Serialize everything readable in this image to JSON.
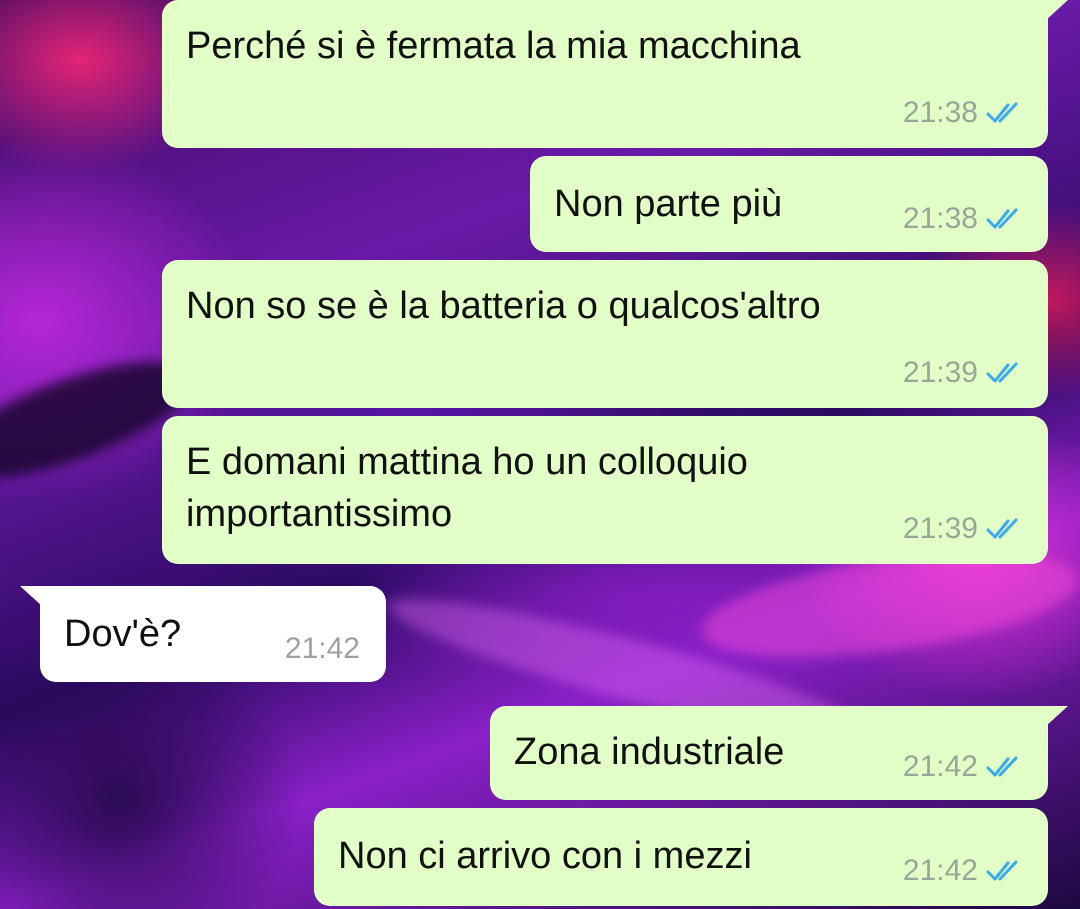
{
  "colors": {
    "outgoing_bubble": "#e2ffc7",
    "incoming_bubble": "#ffffff",
    "read_ticks": "#3aa9ee"
  },
  "messages": [
    {
      "direction": "outgoing",
      "text": "Perché si è fermata la mia macchina",
      "time": "21:38",
      "status_icon": "double-check-icon"
    },
    {
      "direction": "outgoing",
      "text": "Non parte più",
      "time": "21:38",
      "status_icon": "double-check-icon"
    },
    {
      "direction": "outgoing",
      "text": "Non so se è la batteria o qualcos'altro",
      "time": "21:39",
      "status_icon": "double-check-icon"
    },
    {
      "direction": "outgoing",
      "text_line1": "E domani mattina ho un colloquio",
      "text_line2": "importantissimo",
      "time": "21:39",
      "status_icon": "double-check-icon"
    },
    {
      "direction": "incoming",
      "text": "Dov'è?",
      "time": "21:42"
    },
    {
      "direction": "outgoing",
      "text": "Zona industriale",
      "time": "21:42",
      "status_icon": "double-check-icon"
    },
    {
      "direction": "outgoing",
      "text": "Non ci arrivo con i mezzi",
      "time": "21:42",
      "status_icon": "double-check-icon"
    }
  ]
}
